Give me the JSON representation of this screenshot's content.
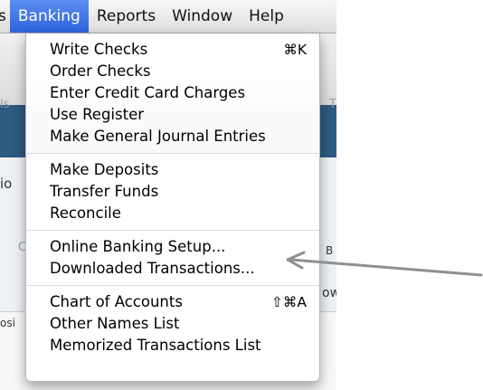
{
  "menubar": {
    "items": [
      {
        "label": "s"
      },
      {
        "label": "Banking"
      },
      {
        "label": "Reports"
      },
      {
        "label": "Window"
      },
      {
        "label": "Help"
      }
    ]
  },
  "background": {
    "fragments": [
      "ls",
      "io",
      "C",
      "osi",
      "B",
      "ow",
      "T"
    ]
  },
  "menu": {
    "groups": [
      [
        {
          "label": "Write Checks",
          "shortcut": "⌘K"
        },
        {
          "label": "Order Checks"
        },
        {
          "label": "Enter Credit Card Charges"
        },
        {
          "label": "Use Register"
        },
        {
          "label": "Make General Journal Entries"
        }
      ],
      [
        {
          "label": "Make Deposits"
        },
        {
          "label": "Transfer Funds"
        },
        {
          "label": "Reconcile"
        }
      ],
      [
        {
          "label": "Online Banking Setup..."
        },
        {
          "label": "Downloaded Transactions..."
        }
      ],
      [
        {
          "label": "Chart of Accounts",
          "shortcut": "⇧⌘A"
        },
        {
          "label": "Other Names List"
        },
        {
          "label": "Memorized Transactions List"
        }
      ]
    ]
  },
  "colors": {
    "menu_highlight": "#2f63dc",
    "arrow": "#8f8f8f",
    "header_blue": "#2d5a80"
  }
}
